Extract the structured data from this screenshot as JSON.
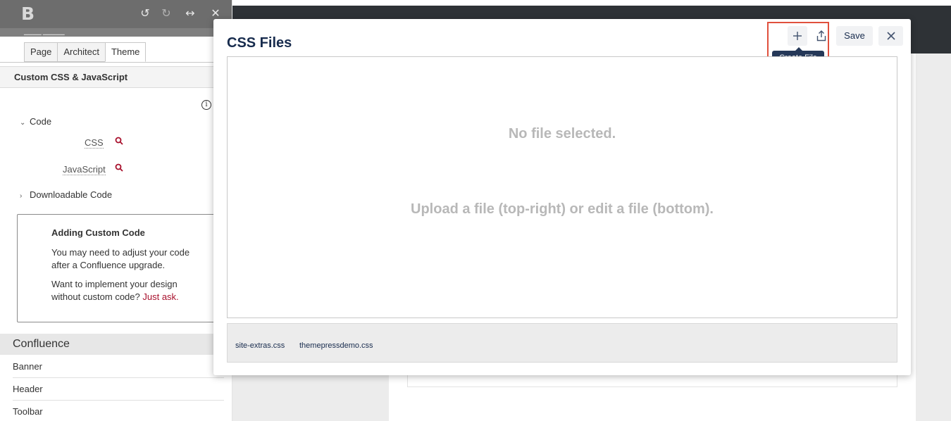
{
  "left_panel": {
    "logo": "B",
    "toolbar": {
      "undo_icon": "undo-icon",
      "redo_icon": "redo-icon",
      "resize_icon": "resize-icon",
      "close_icon": "close-icon"
    },
    "tabs": [
      {
        "label": "Page"
      },
      {
        "label": "Architect"
      },
      {
        "label": "Theme",
        "active": true
      }
    ],
    "section_title": "Custom CSS & JavaScript",
    "tree": {
      "code": {
        "label": "Code",
        "expanded": true,
        "children": [
          "CSS",
          "JavaScript"
        ]
      },
      "downloadable": {
        "label": "Downloadable Code",
        "expanded": false
      }
    },
    "notice": {
      "title": "Adding Custom Code",
      "text1": "You may need to adjust your code after a Confluence upgrade.",
      "text2_prefix": "Want to implement your design without custom code? ",
      "text2_link": "Just ask."
    },
    "confluence": {
      "heading": "Confluence",
      "items": [
        "Banner",
        "Header",
        "Toolbar"
      ]
    }
  },
  "modal": {
    "title": "CSS Files",
    "create_button_icon": "plus-icon",
    "upload_button_icon": "upload-icon",
    "save_label": "Save",
    "close_icon": "close-icon",
    "tooltip": "Create File",
    "empty_title": "No file selected.",
    "empty_hint": "Upload a file (top-right) or edit a file (bottom).",
    "files": [
      "site-extras.css",
      "themepressdemo.css"
    ]
  },
  "colors": {
    "accent_red": "#a8102c",
    "highlight": "#e0503d",
    "tooltip_bg": "#253858",
    "topbar_bg": "#6d6d6d",
    "dark_bar": "#2e3236"
  }
}
